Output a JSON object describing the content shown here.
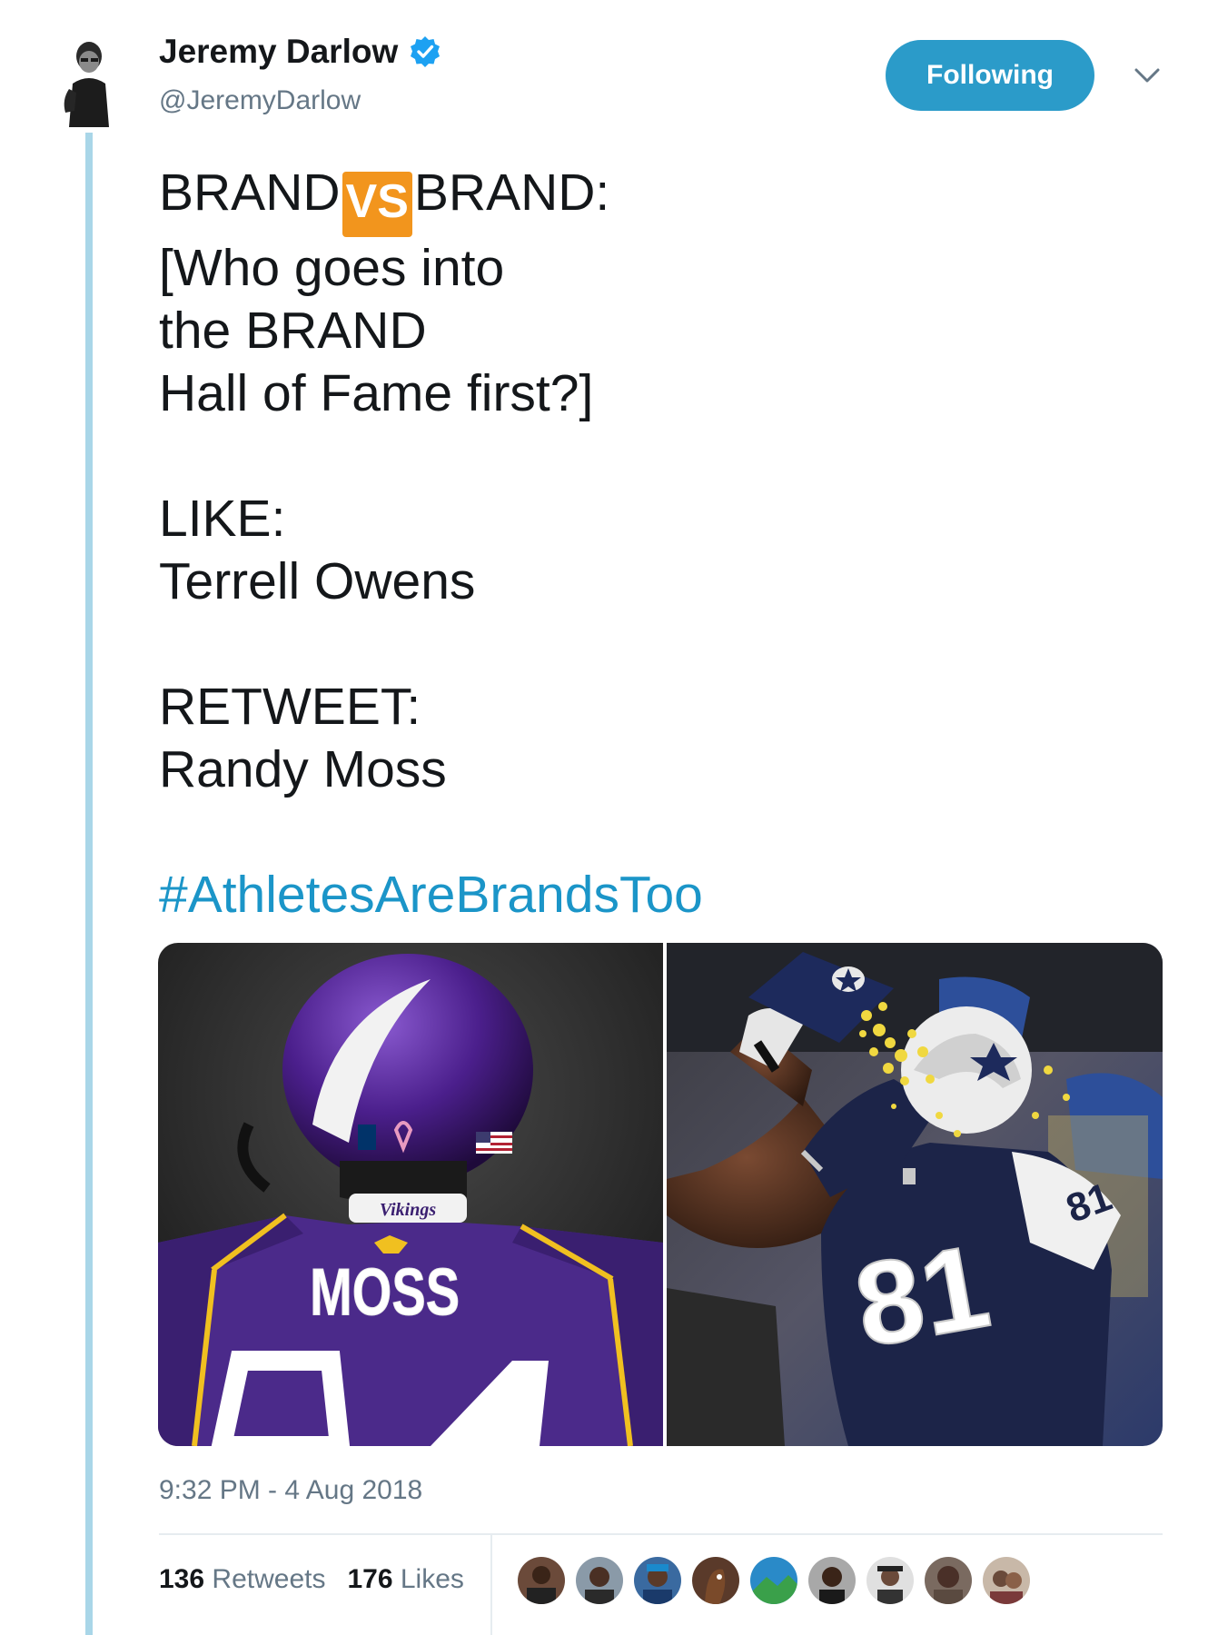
{
  "author": {
    "display_name": "Jeremy Darlow",
    "handle": "@JeremyDarlow",
    "verified": true
  },
  "follow_button": {
    "label": "Following"
  },
  "tweet": {
    "brand_left": "BRAND",
    "vs": "VS",
    "brand_right": "BRAND:",
    "question_line1": "[Who goes into",
    "question_line2": "the BRAND",
    "question_line3": "Hall of Fame first?]",
    "like_label": "LIKE:",
    "like_name": "Terrell Owens",
    "retweet_label": "RETWEET:",
    "retweet_name": "Randy Moss",
    "hashtag": "#AthletesAreBrandsToo"
  },
  "media": {
    "left": {
      "helmet_text": "Vikings",
      "jersey_name": "MOSS"
    },
    "right": {
      "jersey_number": "81",
      "sleeve_number": "81"
    }
  },
  "timestamp": "9:32 PM - 4 Aug 2018",
  "stats": {
    "retweets_count": "136",
    "retweets_label": "Retweets",
    "likes_count": "176",
    "likes_label": "Likes"
  },
  "colors": {
    "accent": "#1b95c8",
    "follow_bg": "#2b9bc9",
    "thread_line": "#a9d6e8",
    "vs_badge": "#f2951d",
    "secondary_text": "#657786",
    "verified": "#1da1f2"
  },
  "icons": {
    "verified": "verified-badge-icon",
    "chevron": "chevron-down-icon"
  },
  "liker_avatar_count": 9
}
